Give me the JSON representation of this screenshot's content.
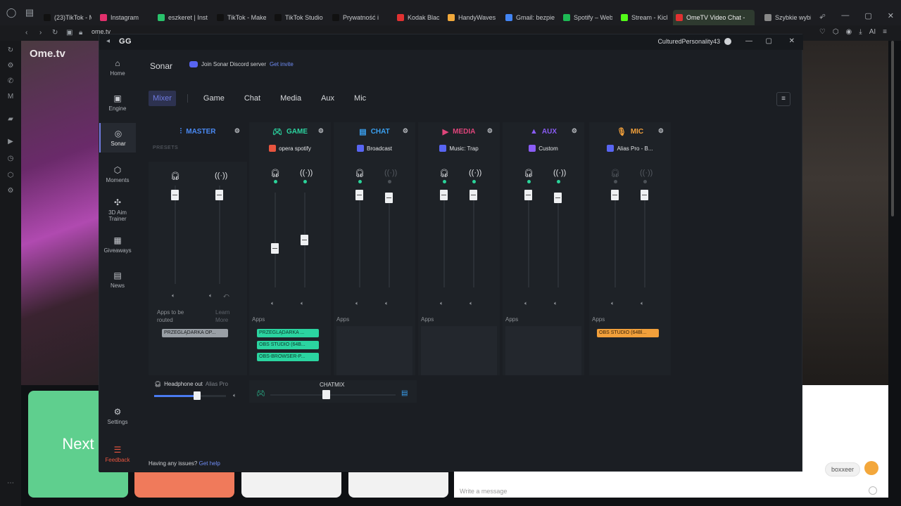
{
  "browser": {
    "tabs": [
      {
        "label": "(23)TikTok - M",
        "color": "#111111"
      },
      {
        "label": "Instagram",
        "color": "#e1306c"
      },
      {
        "label": "eszkeret | Inst",
        "color": "#29c26b"
      },
      {
        "label": "TikTok - Make",
        "color": "#111111"
      },
      {
        "label": "TikTok Studio",
        "color": "#111111"
      },
      {
        "label": "Prywatność i",
        "color": "#111111"
      },
      {
        "label": "Kodak Black -",
        "color": "#e03131"
      },
      {
        "label": "HandyWaves",
        "color": "#f2a93b"
      },
      {
        "label": "Gmail: bezpie",
        "color": "#4285f4"
      },
      {
        "label": "Spotify – Web",
        "color": "#1db954"
      },
      {
        "label": "Stream - Kick",
        "color": "#53fc18"
      },
      {
        "label": "OmeTV Video Chat -",
        "color": "#e03131"
      },
      {
        "label": "Szybkie wybie",
        "color": "#888888"
      }
    ],
    "url": "ome.tv",
    "new_tab": "+",
    "right_toolbar_text": "AI"
  },
  "background_page": {
    "logo": "Ome.tv",
    "next_button": "Next",
    "chat_user": "boxxeer",
    "message_placeholder": "Write a message"
  },
  "gg": {
    "logo": "GG",
    "username": "CulturedPersonality43",
    "nav": [
      {
        "label": "Home",
        "icon": "⌂"
      },
      {
        "label": "Engine",
        "icon": "▣"
      },
      {
        "label": "Sonar",
        "icon": "◎"
      },
      {
        "label": "Moments",
        "icon": "⬡"
      },
      {
        "label": "3D Aim Trainer",
        "icon": "✣"
      },
      {
        "label": "Giveaways",
        "icon": "▦"
      },
      {
        "label": "News",
        "icon": "▤"
      },
      {
        "label": "Settings",
        "icon": "⚙"
      },
      {
        "label": "Feedback",
        "icon": "☰"
      }
    ],
    "page_title": "Sonar",
    "discord_text": "Join Sonar Discord server",
    "discord_link": "Get invite",
    "tabs": [
      "Mixer",
      "Game",
      "Chat",
      "Media",
      "Aux",
      "Mic"
    ],
    "menu_icon": "≡",
    "presets_label": "PRESETS",
    "channels": {
      "master": {
        "name": "MASTER",
        "color": "#4a8af4"
      },
      "game": {
        "name": "GAME",
        "preset": "opera spotify",
        "color": "#2bd4a0"
      },
      "chat": {
        "name": "CHAT",
        "preset": "Broadcast",
        "color": "#3aa0f0"
      },
      "media": {
        "name": "MEDIA",
        "preset": "Music: Trap",
        "color": "#e0457b"
      },
      "aux": {
        "name": "AUX",
        "preset": "Custom",
        "color": "#8a5cf5"
      },
      "mic": {
        "name": "MIC",
        "preset": "Alias Pro - B...",
        "color": "#f2a03b"
      }
    },
    "apps_label": "Apps",
    "apps_to_be_routed": "Apps to be routed",
    "learn_more": "Learn More",
    "routed_app": "PRZEGLĄDARKA OP...",
    "game_apps": [
      "PRZEGLĄDARKA ...",
      "OBS STUDIO (64B...",
      "OBS-BROWSER-P..."
    ],
    "mic_app": "OBS STUDIO (64Bl...",
    "headphone_out": "Headphone out",
    "headphone_device": "Alias Pro",
    "chatmix_label": "CHATMIX",
    "help_text": "Having any issues?",
    "help_link": "Get help"
  }
}
